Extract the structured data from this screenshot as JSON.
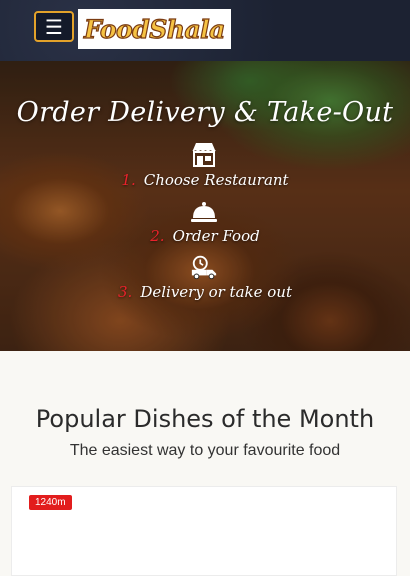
{
  "header": {
    "menu_icon": "hamburger-icon",
    "menu_glyph": "☰",
    "logo_text": "FoodShala"
  },
  "hero": {
    "title": "Order Delivery & Take-Out",
    "steps": [
      {
        "number": "1.",
        "label": "Choose Restaurant",
        "icon": "restaurant-icon"
      },
      {
        "number": "2.",
        "label": "Order Food",
        "icon": "cloche-icon"
      },
      {
        "number": "3.",
        "label": "Delivery or take out",
        "icon": "delivery-truck-icon"
      }
    ]
  },
  "popular": {
    "title": "Popular Dishes of the Month",
    "subtitle": "The easiest way to your favourite food"
  },
  "cards": [
    {
      "distance": "1240m"
    }
  ],
  "colors": {
    "navbar_bg": "#1f2536",
    "menu_border": "#e3a22a",
    "accent_red": "#e8222b",
    "badge_red": "#e21d1d",
    "logo_fill": "#f5c243"
  }
}
